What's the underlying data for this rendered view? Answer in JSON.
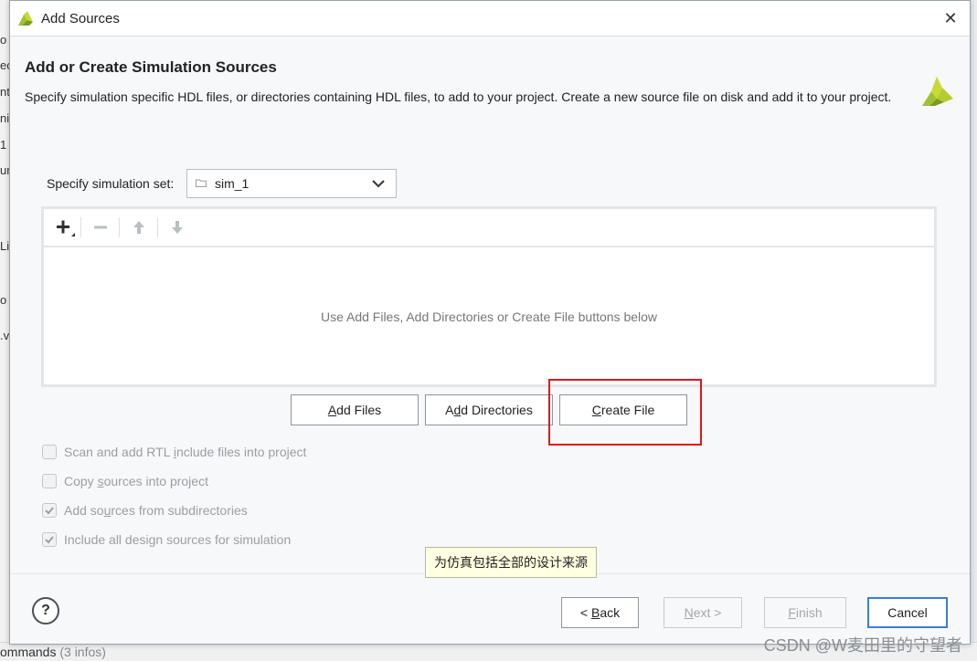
{
  "background": {
    "left_fragments": [
      "o",
      "ec",
      "nt",
      "ni",
      "1",
      "ur",
      "Li",
      "o",
      ".v"
    ],
    "bottom_text": "ommands",
    "bottom_text_dim": "(3 infos)"
  },
  "dialog": {
    "title": "Add Sources",
    "close_label": "✕",
    "heading": "Add or Create Simulation Sources",
    "description": "Specify simulation specific HDL files, or directories containing HDL files, to add to your project. Create a new source file on disk and add it to your project.",
    "simset": {
      "label": "Specify simulation set:",
      "value": "sim_1"
    },
    "file_panel": {
      "empty_message": "Use Add Files, Add Directories or Create File buttons below",
      "toolbar": [
        "add-icon",
        "remove-icon",
        "move-up-icon",
        "move-down-icon"
      ]
    },
    "buttons": {
      "add_files": {
        "underline": "A",
        "rest": "dd Files"
      },
      "add_directories": {
        "pre": "A",
        "underline": "d",
        "rest": "d Directories"
      },
      "create_file": {
        "underline": "C",
        "rest": "reate File"
      }
    },
    "options": [
      {
        "pre": "Scan and add RTL ",
        "underline": "i",
        "rest": "nclude files into project",
        "checked": false
      },
      {
        "pre": "Copy ",
        "underline": "s",
        "rest": "ources into project",
        "checked": false
      },
      {
        "pre": "Add so",
        "underline": "u",
        "rest": "rces from subdirectories",
        "checked": true
      },
      {
        "pre": "Include all design sources for simulation",
        "underline": "",
        "rest": "",
        "checked": true
      }
    ],
    "tooltip": "为仿真包括全部的设计来源",
    "footer": {
      "help": "?",
      "back": {
        "pre": "< ",
        "underline": "B",
        "rest": "ack"
      },
      "next": {
        "underline": "N",
        "rest": "ext >"
      },
      "finish": {
        "underline": "F",
        "rest": "inish"
      },
      "cancel": "Cancel"
    }
  },
  "watermark": "CSDN @W麦田里的守望者",
  "colors": {
    "accent": "#3c7fd3",
    "highlight": "#e0161b",
    "logo": "#9fc230"
  }
}
